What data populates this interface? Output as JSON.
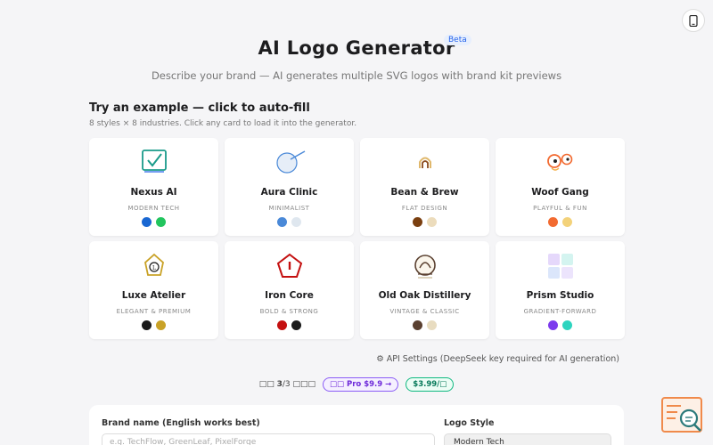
{
  "header": {
    "title": "AI Logo Generator",
    "badge": "Beta",
    "subtitle": "Describe your brand — AI generates multiple SVG logos with brand kit previews"
  },
  "examples": {
    "heading": "Try an example — click to auto-fill",
    "subheading": "8 styles × 8 industries. Click any card to load it into the generator.",
    "cards": [
      {
        "name": "Nexus AI",
        "style": "MODERN TECH",
        "icon": "checkmark-box-icon",
        "colors": [
          "#1967d2",
          "#22c55e"
        ]
      },
      {
        "name": "Aura Clinic",
        "style": "MINIMALIST",
        "icon": "circle-orbit-icon",
        "colors": [
          "#4a89d8",
          "#dfe7ef"
        ]
      },
      {
        "name": "Bean & Brew",
        "style": "FLAT DESIGN",
        "icon": "coffee-bean-icon",
        "colors": [
          "#7a3f10",
          "#ecdcbc"
        ]
      },
      {
        "name": "Woof Gang",
        "style": "PLAYFUL & FUN",
        "icon": "dog-eyes-icon",
        "colors": [
          "#f26a30",
          "#f3d27a"
        ]
      },
      {
        "name": "Luxe Atelier",
        "style": "ELEGANT & PREMIUM",
        "icon": "pentagon-gem-icon",
        "colors": [
          "#1a1a1a",
          "#c9a227"
        ]
      },
      {
        "name": "Iron Core",
        "style": "BOLD & STRONG",
        "icon": "shield-pentagon-icon",
        "colors": [
          "#c41010",
          "#1a1a1a"
        ]
      },
      {
        "name": "Old Oak Distillery",
        "style": "VINTAGE & CLASSIC",
        "icon": "barrel-badge-icon",
        "colors": [
          "#5a4030",
          "#e8dcc0"
        ]
      },
      {
        "name": "Prism Studio",
        "style": "GRADIENT-FORWARD",
        "icon": "prism-tiles-icon",
        "colors": [
          "#7c3aed",
          "#2dd4bf"
        ]
      }
    ]
  },
  "api_settings": "⚙ API Settings (DeepSeek key required for AI generation)",
  "usage": {
    "prefix": "□□",
    "count": "3",
    "total": "/3 □□□",
    "pro_label": "□□ Pro $9.9 →",
    "price_label": "$3.99/□"
  },
  "form": {
    "brand_label": "Brand name (English works best)",
    "brand_placeholder": "e.g. TechFlow, GreenLeaf, PixelForge",
    "style_label": "Logo Style",
    "style_value": "Modern Tech"
  },
  "icons": {
    "top_button": "phone-icon",
    "fab": "search-document-icon"
  }
}
